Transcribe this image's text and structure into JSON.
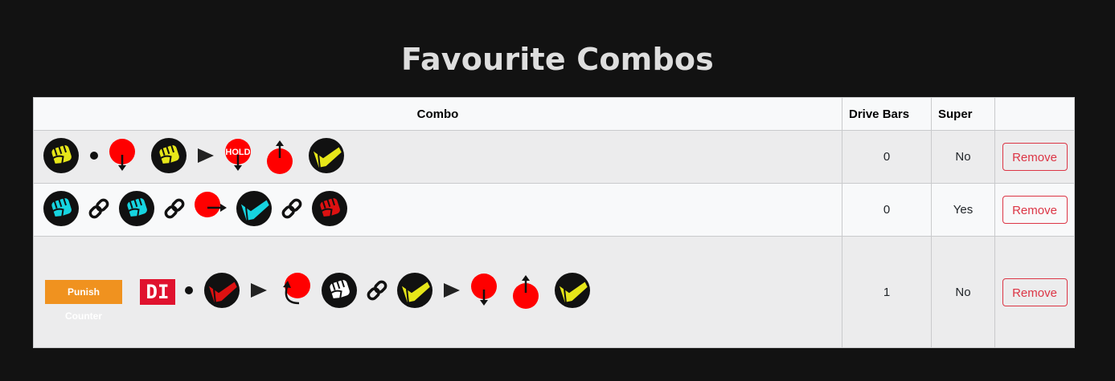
{
  "page": {
    "title": "Favourite Combos"
  },
  "table": {
    "headers": {
      "combo": "Combo",
      "drive_bars": "Drive Bars",
      "super": "Super",
      "actions": ""
    },
    "rows": [
      {
        "drive_bars": "0",
        "super": "No",
        "remove_label": "Remove",
        "sequence": [
          "punch-yellow-icon",
          "dot-separator-icon",
          "down-motion-icon",
          "punch-yellow-icon",
          "followup-arrow-icon",
          "hold-down-motion-icon",
          "up-motion-icon",
          "kick-yellow-icon"
        ]
      },
      {
        "drive_bars": "0",
        "super": "Yes",
        "remove_label": "Remove",
        "sequence": [
          "punch-cyan-icon",
          "link-icon",
          "punch-cyan-icon",
          "link-icon",
          "forward-motion-icon",
          "kick-cyan-icon",
          "link-icon",
          "punch-red-icon"
        ]
      },
      {
        "drive_bars": "1",
        "super": "No",
        "remove_label": "Remove",
        "badges": {
          "punish_counter": "Punish Counter",
          "drive_impact": "DI"
        },
        "sequence": [
          "punish-counter-badge",
          "drive-impact-badge",
          "dot-separator-icon",
          "kick-red-icon",
          "followup-arrow-icon",
          "quarter-circle-back-icon",
          "punch-white-icon",
          "link-icon",
          "kick-yellow-icon",
          "followup-arrow-icon",
          "down-motion-icon",
          "up-motion-icon",
          "kick-yellow-icon"
        ]
      }
    ]
  },
  "colors": {
    "light": "#e6e619",
    "medium": "#16d4e0",
    "heavy": "#dd1111",
    "neutral": "#ffffff",
    "remove": "#dc3545",
    "punish_counter": "#f0921f",
    "drive_impact": "#e0122e"
  }
}
